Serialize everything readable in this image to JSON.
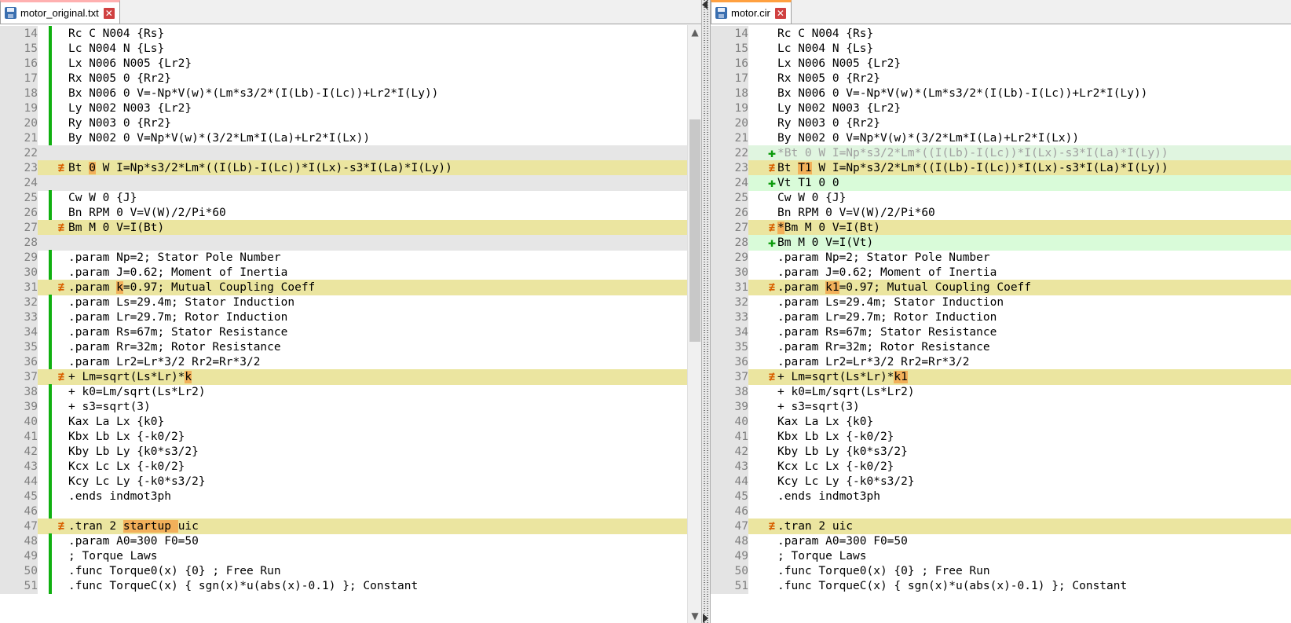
{
  "left": {
    "tab_title": "motor_original.txt",
    "lines": [
      {
        "n": "14",
        "t": "Rc C N004 {Rs}",
        "bar": true
      },
      {
        "n": "15",
        "t": "Lc N004 N {Ls}",
        "bar": true
      },
      {
        "n": "16",
        "t": "Lx N006 N005 {Lr2}",
        "bar": true
      },
      {
        "n": "17",
        "t": "Rx N005 0 {Rr2}",
        "bar": true
      },
      {
        "n": "18",
        "t": "Bx N006 0 V=-Np*V(w)*(Lm*s3/2*(I(Lb)-I(Lc))+Lr2*I(Ly))",
        "bar": true
      },
      {
        "n": "19",
        "t": "Ly N002 N003 {Lr2}",
        "bar": true
      },
      {
        "n": "20",
        "t": "Ry N003 0 {Rr2}",
        "bar": true
      },
      {
        "n": "21",
        "t": "By N002 0 V=Np*V(w)*(3/2*Lm*I(La)+Lr2*I(Lx))",
        "bar": true
      },
      {
        "n": "22",
        "t": "",
        "state": "placeholder"
      },
      {
        "n": "23",
        "pre": "Bt ",
        "hl": "0",
        "post": " W I=Np*s3/2*Lm*((I(Lb)-I(Lc))*I(Lx)-s3*I(La)*I(Ly))",
        "state": "changed",
        "mark": "changed"
      },
      {
        "n": "24",
        "t": "",
        "state": "placeholder"
      },
      {
        "n": "25",
        "t": "Cw W 0 {J}",
        "bar": true
      },
      {
        "n": "26",
        "t": "Bn RPM 0 V=V(W)/2/Pi*60",
        "bar": true
      },
      {
        "n": "27",
        "t": "Bm M 0 V=I(Bt)",
        "state": "changed",
        "mark": "changed"
      },
      {
        "n": "28",
        "t": "",
        "state": "placeholder"
      },
      {
        "n": "29",
        "t": ".param Np=2; Stator Pole Number",
        "bar": true
      },
      {
        "n": "30",
        "t": ".param J=0.62; Moment of Inertia",
        "bar": true
      },
      {
        "n": "31",
        "pre": ".param ",
        "hl": "k",
        "post": "=0.97; Mutual Coupling Coeff",
        "state": "changed",
        "mark": "changed"
      },
      {
        "n": "32",
        "t": ".param Ls=29.4m; Stator Induction",
        "bar": true
      },
      {
        "n": "33",
        "t": ".param Lr=29.7m; Rotor Induction",
        "bar": true
      },
      {
        "n": "34",
        "t": ".param Rs=67m; Stator Resistance",
        "bar": true
      },
      {
        "n": "35",
        "t": ".param Rr=32m; Rotor Resistance",
        "bar": true
      },
      {
        "n": "36",
        "t": ".param Lr2=Lr*3/2 Rr2=Rr*3/2",
        "bar": true
      },
      {
        "n": "37",
        "pre": "+ Lm=sqrt(Ls*Lr)*",
        "hl": "k",
        "post": "",
        "state": "changed",
        "mark": "changed"
      },
      {
        "n": "38",
        "t": "+ k0=Lm/sqrt(Ls*Lr2)",
        "bar": true
      },
      {
        "n": "39",
        "t": "+ s3=sqrt(3)",
        "bar": true
      },
      {
        "n": "40",
        "t": "Kax La Lx {k0}",
        "bar": true
      },
      {
        "n": "41",
        "t": "Kbx Lb Lx {-k0/2}",
        "bar": true
      },
      {
        "n": "42",
        "t": "Kby Lb Ly {k0*s3/2}",
        "bar": true
      },
      {
        "n": "43",
        "t": "Kcx Lc Lx {-k0/2}",
        "bar": true
      },
      {
        "n": "44",
        "t": "Kcy Lc Ly {-k0*s3/2}",
        "bar": true
      },
      {
        "n": "45",
        "t": ".ends indmot3ph",
        "bar": true
      },
      {
        "n": "46",
        "t": "",
        "bar": true
      },
      {
        "n": "47",
        "pre": ".tran 2 ",
        "hl": "startup ",
        "post": "uic",
        "state": "changed",
        "mark": "changed"
      },
      {
        "n": "48",
        "t": ".param A0=300 F0=50",
        "bar": true
      },
      {
        "n": "49",
        "t": "; Torque Laws",
        "bar": true
      },
      {
        "n": "50",
        "t": ".func Torque0(x) {0} ; Free Run",
        "bar": true
      },
      {
        "n": "51",
        "t": ".func TorqueC(x) { sgn(x)*u(abs(x)-0.1) }; Constant",
        "bar": true
      }
    ]
  },
  "right": {
    "tab_title": "motor.cir",
    "lines": [
      {
        "n": "14",
        "t": "Rc C N004 {Rs}"
      },
      {
        "n": "15",
        "t": "Lc N004 N {Ls}"
      },
      {
        "n": "16",
        "t": "Lx N006 N005 {Lr2}"
      },
      {
        "n": "17",
        "t": "Rx N005 0 {Rr2}"
      },
      {
        "n": "18",
        "t": "Bx N006 0 V=-Np*V(w)*(Lm*s3/2*(I(Lb)-I(Lc))+Lr2*I(Ly))"
      },
      {
        "n": "19",
        "t": "Ly N002 N003 {Lr2}"
      },
      {
        "n": "20",
        "t": "Ry N003 0 {Rr2}"
      },
      {
        "n": "21",
        "t": "By N002 0 V=Np*V(w)*(3/2*Lm*I(La)+Lr2*I(Lx))"
      },
      {
        "n": "22",
        "t": "*Bt 0 W I=Np*s3/2*Lm*((I(Lb)-I(Lc))*I(Lx)-s3*I(La)*I(Ly))",
        "state": "moved",
        "mark": "added"
      },
      {
        "n": "23",
        "pre": "Bt ",
        "hl": "T1",
        "post": " W I=Np*s3/2*Lm*((I(Lb)-I(Lc))*I(Lx)-s3*I(La)*I(Ly))",
        "state": "changed",
        "mark": "changed"
      },
      {
        "n": "24",
        "t": "Vt T1 0 0",
        "state": "added",
        "mark": "added"
      },
      {
        "n": "25",
        "t": "Cw W 0 {J}"
      },
      {
        "n": "26",
        "t": "Bn RPM 0 V=V(W)/2/Pi*60"
      },
      {
        "n": "27",
        "pre": "",
        "hl": "*",
        "post": "Bm M 0 V=I(Bt)",
        "state": "changed",
        "mark": "changed"
      },
      {
        "n": "28",
        "t": "Bm M 0 V=I(Vt)",
        "state": "added",
        "mark": "added"
      },
      {
        "n": "29",
        "t": ".param Np=2; Stator Pole Number"
      },
      {
        "n": "30",
        "t": ".param J=0.62; Moment of Inertia"
      },
      {
        "n": "31",
        "pre": ".param ",
        "hl": "k1",
        "post": "=0.97; Mutual Coupling Coeff",
        "state": "changed",
        "mark": "changed"
      },
      {
        "n": "32",
        "t": ".param Ls=29.4m; Stator Induction"
      },
      {
        "n": "33",
        "t": ".param Lr=29.7m; Rotor Induction"
      },
      {
        "n": "34",
        "t": ".param Rs=67m; Stator Resistance"
      },
      {
        "n": "35",
        "t": ".param Rr=32m; Rotor Resistance"
      },
      {
        "n": "36",
        "t": ".param Lr2=Lr*3/2 Rr2=Rr*3/2"
      },
      {
        "n": "37",
        "pre": "+ Lm=sqrt(Ls*Lr)*",
        "hl": "k1",
        "post": "",
        "state": "changed",
        "mark": "changed"
      },
      {
        "n": "38",
        "t": "+ k0=Lm/sqrt(Ls*Lr2)"
      },
      {
        "n": "39",
        "t": "+ s3=sqrt(3)"
      },
      {
        "n": "40",
        "t": "Kax La Lx {k0}"
      },
      {
        "n": "41",
        "t": "Kbx Lb Lx {-k0/2}"
      },
      {
        "n": "42",
        "t": "Kby Lb Ly {k0*s3/2}"
      },
      {
        "n": "43",
        "t": "Kcx Lc Lx {-k0/2}"
      },
      {
        "n": "44",
        "t": "Kcy Lc Ly {-k0*s3/2}"
      },
      {
        "n": "45",
        "t": ".ends indmot3ph"
      },
      {
        "n": "46",
        "t": ""
      },
      {
        "n": "47",
        "t": ".tran 2 uic",
        "state": "changed",
        "mark": "changed"
      },
      {
        "n": "48",
        "t": ".param A0=300 F0=50"
      },
      {
        "n": "49",
        "t": "; Torque Laws"
      },
      {
        "n": "50",
        "t": ".func Torque0(x) {0} ; Free Run"
      },
      {
        "n": "51",
        "t": ".func TorqueC(x) { sgn(x)*u(abs(x)-0.1) }; Constant"
      }
    ]
  },
  "icons": {
    "close_glyph": "✕",
    "scroll_up_glyph": "▲",
    "scroll_down_glyph": "▼",
    "changed_marker": "≢",
    "added_marker": "✚"
  },
  "colors": {
    "changed_line": "#ebe5a0",
    "added_line": "#d9fbd9",
    "inline_highlight": "#f2b05a",
    "change_bar": "#10b010"
  }
}
